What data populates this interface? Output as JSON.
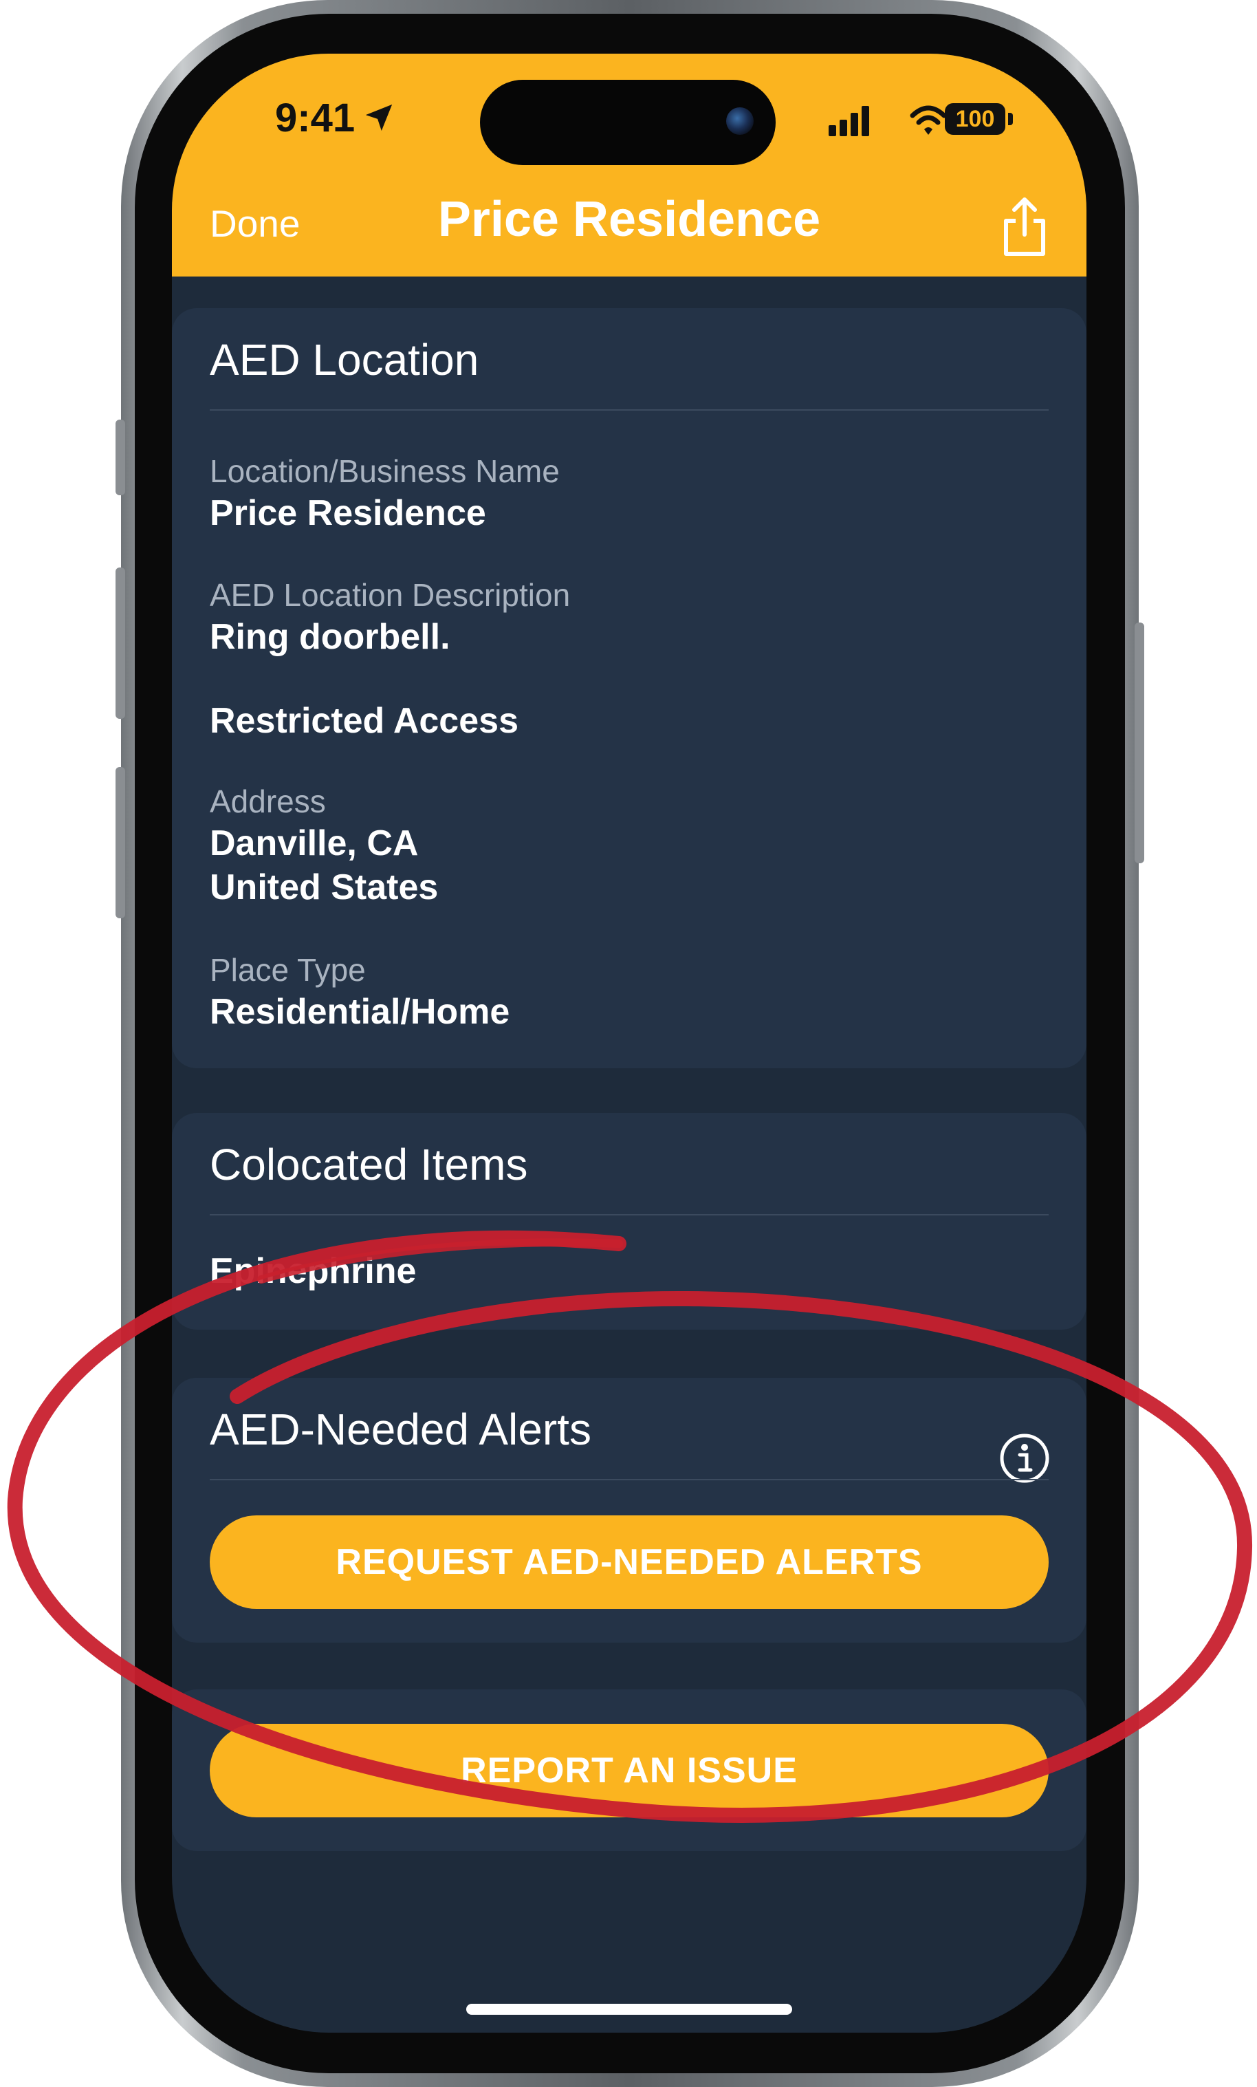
{
  "status_bar": {
    "time": "9:41",
    "battery": "100"
  },
  "nav": {
    "done_label": "Done",
    "title": "Price Residence"
  },
  "aed_location": {
    "heading": "AED Location",
    "fields": [
      {
        "label": "Location/Business Name",
        "value": "Price Residence"
      },
      {
        "label": "AED Location Description",
        "value": "Ring doorbell."
      },
      {
        "label": "",
        "value": "Restricted Access"
      },
      {
        "label": "Address",
        "value_lines": [
          "Danville, CA",
          "United States"
        ]
      },
      {
        "label": "Place Type",
        "value": "Residential/Home"
      }
    ]
  },
  "colocated": {
    "heading": "Colocated Items",
    "items": [
      "Epinephrine"
    ]
  },
  "alerts": {
    "heading": "AED-Needed Alerts",
    "button_label": "REQUEST AED-NEEDED ALERTS"
  },
  "report": {
    "button_label": "REPORT AN ISSUE"
  },
  "colors": {
    "accent": "#fbb41f",
    "background": "#1e2b3b",
    "card": "#243347",
    "annotation": "#c8202e"
  },
  "icons": [
    "location-arrow-icon",
    "signal-icon",
    "wifi-icon",
    "battery-icon",
    "share-icon",
    "info-icon"
  ]
}
